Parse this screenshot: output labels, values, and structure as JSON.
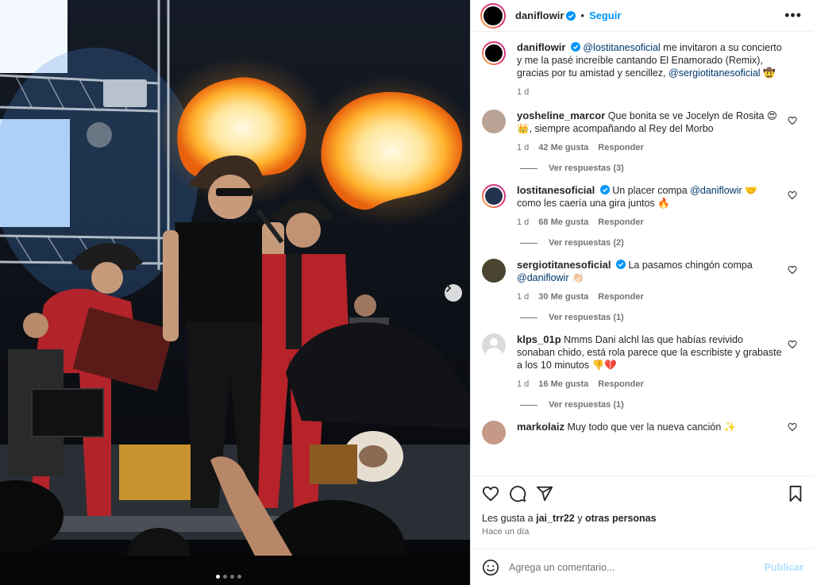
{
  "header": {
    "username": "daniflowir",
    "separator": "•",
    "follow_label": "Seguir",
    "more": "•••"
  },
  "caption": {
    "username": "daniflowir",
    "mention_1": "@lostitanesoficial",
    "text_1": " me invitaron a su concierto y me la pasé increíble cantando El Enamorado (Remix), gracias por tu amistad y sencillez, ",
    "mention_2": "@sergiotitanesoficial",
    "emoji": " 🤠",
    "time": "1 d"
  },
  "comments": [
    {
      "username": "yosheline_marcor",
      "text": "Que bonita se ve Jocelyn de Rosita 😍👑, siempre acompañando al Rey del Morbo",
      "time": "1 d",
      "likes": "42 Me gusta",
      "reply": "Responder",
      "replies": "Ver respuestas (3)"
    },
    {
      "username": "lostitanesoficial",
      "text_pre": "Un placer compa ",
      "mention": "@daniflowir",
      "text_post": " 🤝 como les caería una gira juntos 🔥",
      "time": "1 d",
      "likes": "68 Me gusta",
      "reply": "Responder",
      "replies": "Ver respuestas (2)"
    },
    {
      "username": "sergiotitanesoficial",
      "text_pre": "La pasamos chingón compa ",
      "mention": "@daniflowir",
      "text_post": " 👏🏻",
      "time": "1 d",
      "likes": "30 Me gusta",
      "reply": "Responder",
      "replies": "Ver respuestas (1)"
    },
    {
      "username": "klps_01p",
      "text": "Nmms Dani alchl las que habías revivido sonaban chido, está rola parece que la escribiste y grabaste a los 10 minutos 👎💔",
      "time": "1 d",
      "likes": "16 Me gusta",
      "reply": "Responder",
      "replies": "Ver respuestas (1)"
    },
    {
      "username": "markolaiz",
      "text": "Muy todo que ver la nueva canción ✨"
    }
  ],
  "actions": {
    "likes_prefix": "Les gusta a ",
    "likes_user": "jai_trr22",
    "likes_mid": " y ",
    "likes_others": "otras personas",
    "posted_ago": "Hace un día"
  },
  "composer": {
    "placeholder": "Agrega un comentario...",
    "publish_label": "Publicar"
  },
  "colors": {
    "accent": "#0095f6",
    "publish_disabled": "#b2dffc",
    "verified": "#0095f6",
    "muted": "#737373"
  },
  "icons": [
    "verified-icon",
    "heart-icon",
    "comment-icon",
    "share-icon",
    "save-icon",
    "emoji-icon",
    "chevron-right-icon",
    "more-icon"
  ]
}
